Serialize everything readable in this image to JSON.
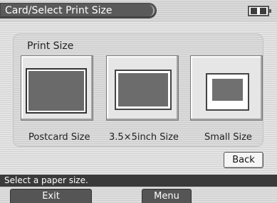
{
  "header": {
    "title": "Card/Select Print Size",
    "battery_icon": "battery-full-icon"
  },
  "panel": {
    "title": "Print Size",
    "options": [
      {
        "label": "Postcard Size",
        "icon": "postcard-paper-icon",
        "selected": true
      },
      {
        "label": "3.5×5inch Size",
        "icon": "photo-paper-icon",
        "selected": false
      },
      {
        "label": "Small Size",
        "icon": "small-paper-icon",
        "selected": false
      }
    ]
  },
  "buttons": {
    "back": "Back"
  },
  "status": {
    "message": "Select a paper size."
  },
  "footer": {
    "exit": "Exit",
    "menu": "Menu"
  }
}
